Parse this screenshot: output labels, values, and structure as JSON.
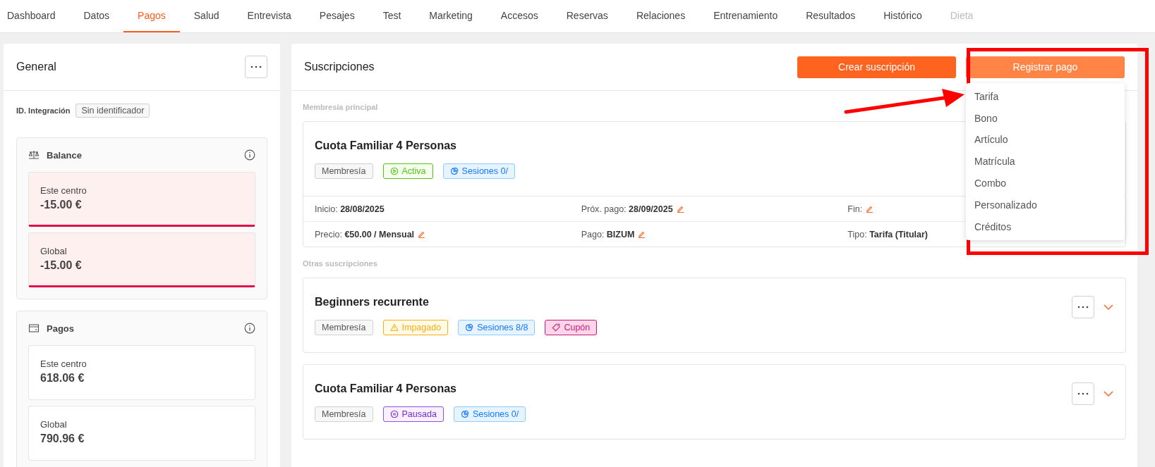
{
  "tabs": [
    {
      "label": "Dashboard",
      "selected": false,
      "disabled": false
    },
    {
      "label": "Datos",
      "selected": false,
      "disabled": false
    },
    {
      "label": "Pagos",
      "selected": true,
      "disabled": false
    },
    {
      "label": "Salud",
      "selected": false,
      "disabled": false
    },
    {
      "label": "Entrevista",
      "selected": false,
      "disabled": false
    },
    {
      "label": "Pesajes",
      "selected": false,
      "disabled": false
    },
    {
      "label": "Test",
      "selected": false,
      "disabled": false
    },
    {
      "label": "Marketing",
      "selected": false,
      "disabled": false
    },
    {
      "label": "Accesos",
      "selected": false,
      "disabled": false
    },
    {
      "label": "Reservas",
      "selected": false,
      "disabled": false
    },
    {
      "label": "Relaciones",
      "selected": false,
      "disabled": false
    },
    {
      "label": "Entrenamiento",
      "selected": false,
      "disabled": false
    },
    {
      "label": "Resultados",
      "selected": false,
      "disabled": false
    },
    {
      "label": "Histórico",
      "selected": false,
      "disabled": false
    },
    {
      "label": "Dieta",
      "selected": false,
      "disabled": true
    }
  ],
  "general": {
    "title": "General",
    "integration_label": "ID. Integración",
    "integration_value": "Sin identificador",
    "sections": [
      {
        "kind": "balance",
        "title": "Balance",
        "stats": [
          {
            "label": "Este centro",
            "value": "-15.00 €",
            "alert": true
          },
          {
            "label": "Global",
            "value": "-15.00 €",
            "alert": true
          }
        ]
      },
      {
        "kind": "payments",
        "title": "Pagos",
        "stats": [
          {
            "label": "Este centro",
            "value": "618.06 €",
            "alert": false
          },
          {
            "label": "Global",
            "value": "790.96 €",
            "alert": false
          }
        ]
      }
    ]
  },
  "subscriptions": {
    "title": "Suscripciones",
    "create_button": "Crear suscripción",
    "register_button": {
      "label": "Registrar pago",
      "open": true
    },
    "menu": [
      "Tarifa",
      "Bono",
      "Artículo",
      "Matrícula",
      "Combo",
      "Personalizado",
      "Créditos"
    ],
    "main_label": "Membresía principal",
    "main": {
      "title": "Cuota Familiar 4 Personas",
      "tags": [
        {
          "kind": "plain",
          "label": "Membresía"
        },
        {
          "kind": "active",
          "label": "Activa"
        },
        {
          "kind": "sessions",
          "label": "Sesiones 0/"
        }
      ],
      "details": [
        [
          {
            "text": "Inicio: **28/08/2025**",
            "editable": false
          },
          {
            "text": "Próx. pago: **28/09/2025**",
            "editable": true
          },
          {
            "text": "Fin:",
            "editable": true
          }
        ],
        [
          {
            "text": "Precio: **€50.00 / Mensual**",
            "editable": true
          },
          {
            "text": "Pago: **BIZUM**",
            "editable": true
          },
          {
            "text": "Tipo: **Tarifa (Titular)**",
            "editable": false
          }
        ]
      ]
    },
    "others_label": "Otras suscripciones",
    "others": [
      {
        "title": "Beginners recurrente",
        "tags": [
          {
            "kind": "plain",
            "label": "Membresía"
          },
          {
            "kind": "unpaid",
            "label": "Impagado"
          },
          {
            "kind": "sessions",
            "label": "Sesiones 8/8"
          },
          {
            "kind": "coupon",
            "label": "Cupón"
          }
        ]
      },
      {
        "title": "Cuota Familiar 4 Personas",
        "tags": [
          {
            "kind": "plain",
            "label": "Membresía"
          },
          {
            "kind": "paused",
            "label": "Pausada"
          },
          {
            "kind": "sessions",
            "label": "Sesiones 0/"
          }
        ]
      }
    ]
  }
}
